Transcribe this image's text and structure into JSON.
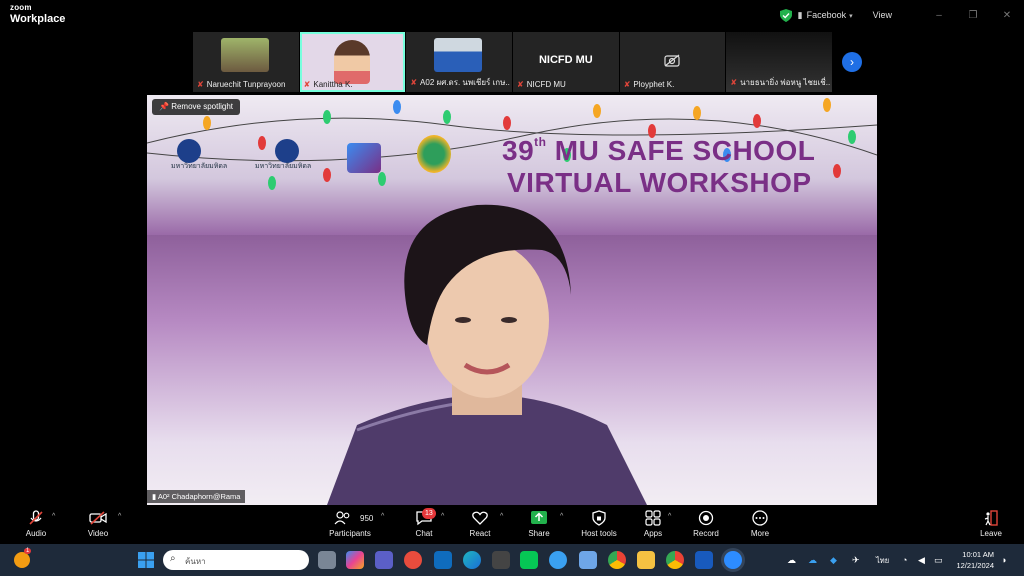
{
  "app": {
    "brand_top": "zoom",
    "brand_bottom": "Workplace"
  },
  "titlebar": {
    "account": "Facebook",
    "view": "View",
    "minimize": "–",
    "maximize": "❐",
    "close": "✕"
  },
  "participants_strip": [
    {
      "name": "Naruechit Tunprayoon",
      "muted": true
    },
    {
      "name": "Kanittha K.",
      "muted": true
    },
    {
      "name": "A02 ผศ.ดร. นพเชียร์ เกษ...",
      "muted": true
    },
    {
      "name": "NICFD MU",
      "muted": true,
      "big_label": "NICFD MU"
    },
    {
      "name": "Ployphet K.",
      "muted": true
    },
    {
      "name": "นายธนายิ่ง พ่อหนู ไชยเชี่...",
      "muted": true
    }
  ],
  "video": {
    "spotlight_button": "Remove spotlight",
    "banner": {
      "num": "39",
      "sup": "th",
      "line1": " MU SAFE SCHOOL",
      "line2": "VIRTUAL WORKSHOP"
    },
    "uni1": "มหาวิทยาลัยมหิดล",
    "uni2": "มหาวิทยาลัยมหิดล",
    "speaker_label": "A0² Chadaphorn@Rama"
  },
  "toolbar": {
    "audio": "Audio",
    "video": "Video",
    "participants": "Participants",
    "participant_count": "950",
    "chat": "Chat",
    "chat_badge": "13",
    "react": "React",
    "share": "Share",
    "host_tools": "Host tools",
    "apps": "Apps",
    "record": "Record",
    "more": "More",
    "leave": "Leave"
  },
  "taskbar": {
    "search_placeholder": "ค้นหา",
    "lang": "ไทย",
    "time": "10:01 AM",
    "date": "12/21/2024",
    "notif_badge": "1"
  },
  "colors": {
    "accent": "#1f6fe5",
    "share_green": "#22b14c",
    "banner_purple": "#7a2f86",
    "muted_red": "#e0453a"
  }
}
